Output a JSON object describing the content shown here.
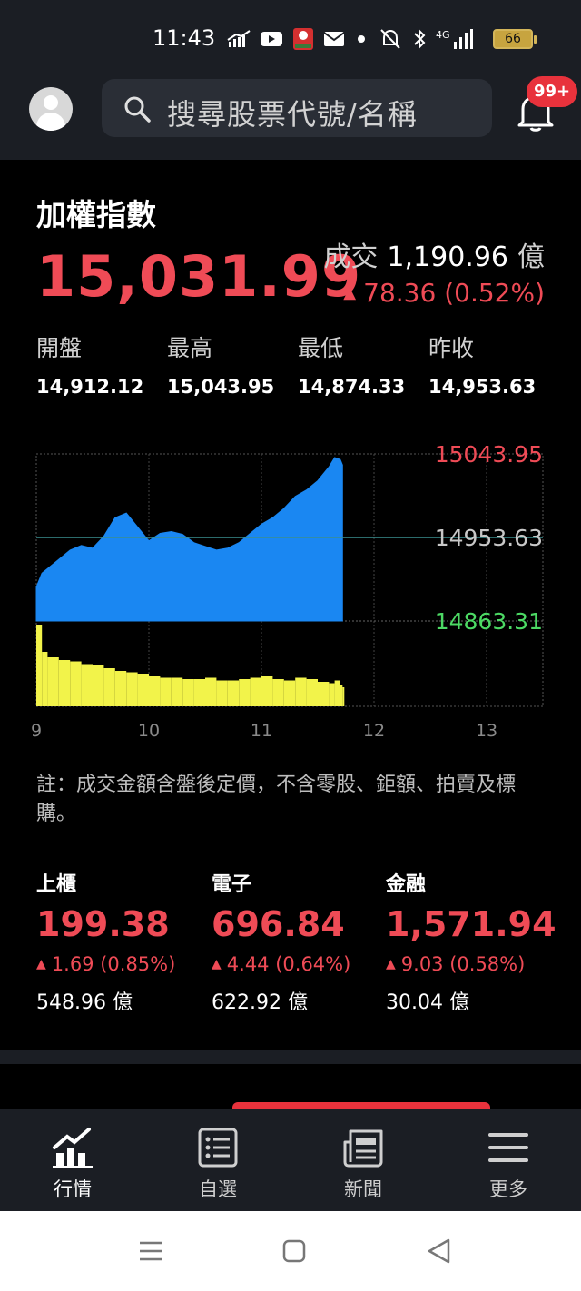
{
  "status_bar": {
    "time": "11:43",
    "battery": "66",
    "network": "4G",
    "icons": [
      "chart-notification-icon",
      "youtube-icon",
      "app-notification-icon",
      "mail-icon",
      "dot-icon",
      "mute-icon",
      "bluetooth-icon",
      "signal-icon",
      "battery-icon"
    ]
  },
  "header": {
    "search_placeholder": "搜尋股票代號/名稱",
    "notification_badge": "99+"
  },
  "index": {
    "title": "加權指數",
    "value": "15,031.99",
    "turnover_label": "成交",
    "turnover_value": "1,190.96",
    "turnover_unit": "億",
    "change": "78.36 (0.52%)",
    "stats": [
      {
        "label": "開盤",
        "value": "14,912.12"
      },
      {
        "label": "最高",
        "value": "15,043.95"
      },
      {
        "label": "最低",
        "value": "14,874.33"
      },
      {
        "label": "昨收",
        "value": "14,953.63"
      }
    ]
  },
  "chart_data": {
    "type": "area",
    "x_ticks": [
      "9",
      "10",
      "11",
      "12",
      "13"
    ],
    "y_ticks": [
      "15043.95",
      "14953.63",
      "14863.31"
    ],
    "ylim": [
      14863.31,
      15043.95
    ],
    "reference_line": 14953.63,
    "x_unit": "hour",
    "x": [
      9.0,
      9.05,
      9.1,
      9.2,
      9.3,
      9.4,
      9.5,
      9.6,
      9.7,
      9.8,
      9.9,
      10.0,
      10.1,
      10.2,
      10.3,
      10.4,
      10.5,
      10.6,
      10.7,
      10.8,
      10.9,
      11.0,
      11.1,
      11.2,
      11.3,
      11.4,
      11.5,
      11.6,
      11.65,
      11.7,
      11.72
    ],
    "series": [
      {
        "values": [
          14900,
          14915,
          14920,
          14930,
          14940,
          14945,
          14942,
          14955,
          14975,
          14980,
          14965,
          14950,
          14958,
          14960,
          14957,
          14948,
          14944,
          14940,
          14942,
          14948,
          14958,
          14968,
          14975,
          14985,
          14998,
          15005,
          15015,
          15030,
          15040,
          15038,
          15032
        ]
      },
      {
        "values": [
          60,
          40,
          36,
          34,
          33,
          31,
          30,
          28,
          26,
          25,
          24,
          22,
          21,
          21,
          20,
          20,
          21,
          19,
          19,
          20,
          21,
          22,
          20,
          19,
          21,
          20,
          18,
          17,
          19,
          16,
          14
        ]
      }
    ],
    "grid": true
  },
  "note": "註：成交金額含盤後定價，不含零股、鉅額、拍賣及標購。",
  "sub_indices": [
    {
      "name": "上櫃",
      "value": "199.38",
      "change": "1.69 (0.85%)",
      "volume": "548.96 億"
    },
    {
      "name": "電子",
      "value": "696.84",
      "change": "4.44 (0.64%)",
      "volume": "622.92 億"
    },
    {
      "name": "金融",
      "value": "1,571.94",
      "change": "9.03 (0.58%)",
      "volume": "30.04 億"
    }
  ],
  "bottom_nav": [
    {
      "label": "行情",
      "icon": "chart-icon",
      "active": true
    },
    {
      "label": "自選",
      "icon": "list-icon",
      "active": false
    },
    {
      "label": "新聞",
      "icon": "news-icon",
      "active": false
    },
    {
      "label": "更多",
      "icon": "menu-icon",
      "active": false
    }
  ],
  "colors": {
    "up": "#ef4b56",
    "down_label": "#4cd964",
    "area_fill": "#1a87f2",
    "volume_fill": "#f2f34a",
    "background": "#000000",
    "bar": "#1b1e24"
  }
}
